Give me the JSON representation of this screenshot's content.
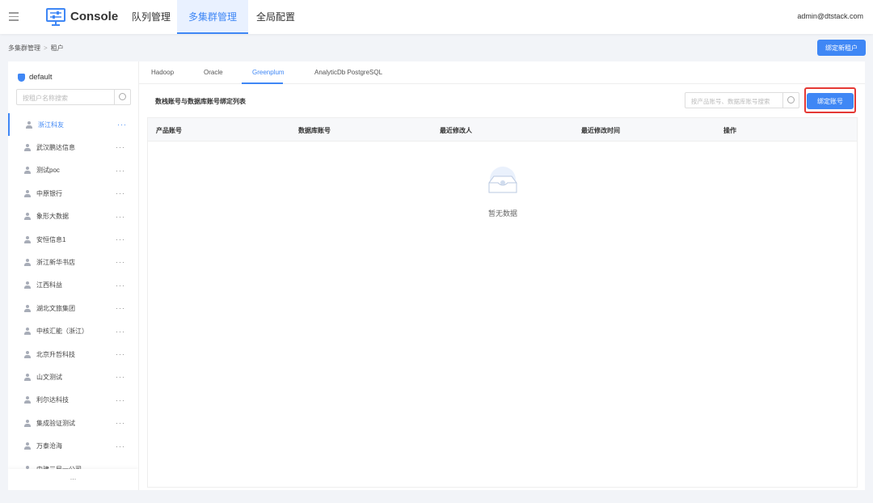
{
  "header": {
    "brand": "Console",
    "nav": [
      "队列管理",
      "多集群管理",
      "全局配置"
    ],
    "active_nav": 1,
    "user": "admin@dtstack.com"
  },
  "breadcrumb": {
    "parent": "多集群管理",
    "current": "租户"
  },
  "bind_tenant_label": "绑定新租户",
  "sidebar": {
    "cluster": "default",
    "search_placeholder": "按租户名称搜索",
    "tenants": [
      "浙江科友",
      "武汉鹏达信息",
      "测试poc",
      "中原银行",
      "象形大数据",
      "安恒信息1",
      "浙江新华书店",
      "江西科益",
      "湖北文旅集团",
      "中核汇能（浙江）",
      "北京升哲科技",
      "山文测试",
      "利尔达科技",
      "集成验证测试",
      "万泰沧海",
      "中建三局一公司"
    ],
    "active": 0,
    "more": "···",
    "footer": "..."
  },
  "main": {
    "tabs": [
      "Hadoop",
      "Oracle",
      "Greenplum",
      "AnalyticDb PostgreSQL"
    ],
    "active_tab": 2,
    "title": "数栈账号与数据库账号绑定列表",
    "search_placeholder": "按产品账号、数据库账号搜索",
    "bind_account_label": "绑定账号",
    "columns": [
      "产品账号",
      "数据库账号",
      "最近修改人",
      "最近修改时间",
      "操作"
    ],
    "empty_text": "暂无数据"
  },
  "colors": {
    "accent": "#3f87f5",
    "highlight": "#e53935"
  }
}
